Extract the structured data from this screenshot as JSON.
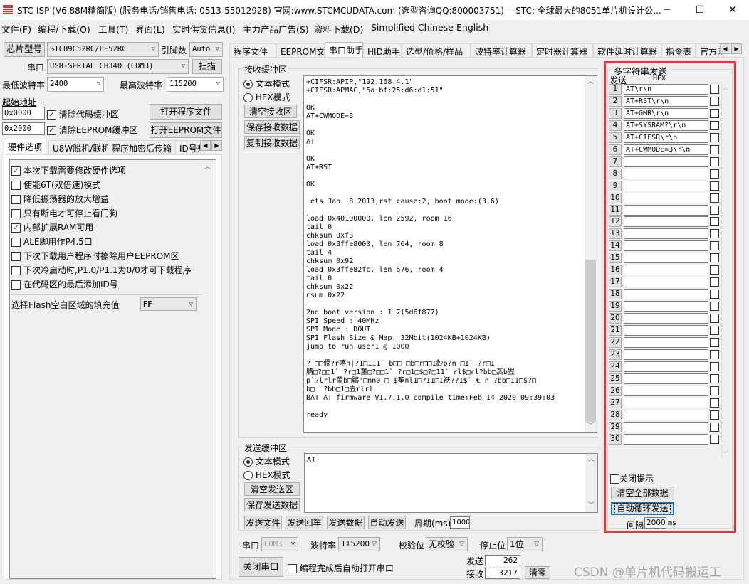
{
  "window": {
    "title": "STC-ISP (V6.88M精简版) (服务电话/销售电话: 0513-55012928) 官网:www.STCMCUDATA.com  (选型咨询QQ:800003751) -- STC: 全球最大的8051单片机设计公...",
    "minimize": "─",
    "maximize": "☐",
    "close": "✕"
  },
  "menu": [
    "文件(F)",
    "编程/下载(O)",
    "工具(T)",
    "界面(L)",
    "实时供货信息(I)",
    "主力产品广告(S)",
    "资料下载(D)",
    "Simplified Chinese",
    "English"
  ],
  "left": {
    "chip_button": "芯片型号",
    "chip_value": "STC89C52RC/LE52RC",
    "pins_label": "引脚数",
    "pins_value": "Auto",
    "port_label": "串口",
    "port_value": "USB-SERIAL CH340 (COM3)",
    "scan_button": "扫描",
    "min_baud_label": "最低波特率",
    "min_baud_value": "2400",
    "max_baud_label": "最高波特率",
    "max_baud_value": "115200",
    "start_addr_label": "起始地址",
    "addr1": "0x0000",
    "clear_code": "清除代码缓冲区",
    "open_prog": "打开程序文件",
    "addr2": "0x2000",
    "clear_eeprom": "清除EEPROM缓冲区",
    "open_eeprom": "打开EEPROM文件",
    "tabs": [
      "硬件选项",
      "U8W脱机/联机",
      "程序加密后传输",
      "ID号升"
    ],
    "options": [
      {
        "label": "本次下载需要修改硬件选项",
        "checked": true
      },
      {
        "label": "使能6T(双倍速)模式",
        "checked": false
      },
      {
        "label": "降低振荡器的放大增益",
        "checked": false
      },
      {
        "label": "只有断电才可停止看门狗",
        "checked": false
      },
      {
        "label": "内部扩展RAM可用",
        "checked": true
      },
      {
        "label": "ALE脚用作P4.5口",
        "checked": false
      },
      {
        "label": "下次下载用户程序时擦除用户EEPROM区",
        "checked": false
      },
      {
        "label": "下次冷启动时,P1.0/P1.1为0/0才可下载程序",
        "checked": false
      },
      {
        "label": "在代码区的最后添加ID号",
        "checked": false
      }
    ],
    "fill_label": "选择Flash空白区域的填充值",
    "fill_value": "FF"
  },
  "tabs": [
    "程序文件",
    "EEPROM文件",
    "串口助手",
    "HID助手",
    "选型/价格/样品",
    "波特率计算器",
    "定时器计算器",
    "软件延时计算器",
    "指令表",
    "官方网"
  ],
  "active_tab": 2,
  "receive": {
    "title": "接收缓冲区",
    "text_mode": "文本模式",
    "hex_mode": "HEX模式",
    "clear": "清空接收区",
    "save": "保存接收数据",
    "copy": "复制接收数据",
    "lines": [
      "+CIFSR:APIP,\"192.168.4.1\"",
      "+CIFSR:APMAC,\"5a:bf:25:d6:d1:51\"",
      "",
      "OK",
      "AT+CWMODE=3",
      "",
      "OK",
      "AT",
      "",
      "OK",
      "AT+RST",
      "",
      "OK",
      "",
      " ets Jan  8 2013,rst cause:2, boot mode:(3,6)",
      "",
      "load 0x40100000, len 2592, room 16",
      "tail 0",
      "chksum 0xf3",
      "load 0x3ffe8000, len 764, room 8",
      "tail 4",
      "chksum 0x92",
      "load 0x3ffe82fc, len 676, room 4",
      "tail 0",
      "chksum 0x22",
      "csum 0x22",
      "",
      "2nd boot version : 1.7(5d6f877)",
      "SPI Speed : 40MHz",
      "SPI Mode : DOUT",
      "SPI Flash Size & Map: 32Mbit(1024KB+1024KB)",
      "jump to run user1 @ 1000",
      "",
      "? □□僴?r喀n|?1□111` b□□ □b□r□□1鈔b?n □1` ?r□1",
      "腈□?□□1` ?r□1菫□?□□1` ?r□1□$□?□11` rl$□rl?bb□蒸b岦",
      "p`?lrlr菫b□鶤'□nn0 □ $筝nl1□?11□1袄??1$` € n ?bb□11□$?□",
      "b□  ?bb□1□岦rlrl",
      "BAT AT firmware V1.7.1.0 compile time:Feb 14 2020 09:39:03",
      "",
      "ready"
    ]
  },
  "send": {
    "title": "发送缓冲区",
    "text_mode": "文本模式",
    "hex_mode": "HEX模式",
    "clear": "清空发送区",
    "save": "保存发送数据",
    "content": "AT",
    "send_file": "发送文件",
    "send_enter": "发送回车",
    "send_data": "发送数据",
    "auto_send": "自动发送",
    "period_label": "周期(ms)",
    "period_value": "1000"
  },
  "serial": {
    "port_label": "串口",
    "port_value": "COM3",
    "baud_label": "波特率",
    "baud_value": "115200",
    "parity_label": "校验位",
    "parity_value": "无校验",
    "stop_label": "停止位",
    "stop_value": "1位",
    "close_port": "关闭串口",
    "auto_open": "编程完成后自动打开串口",
    "sent_label": "发送",
    "sent_value": "262",
    "recv_label": "接收",
    "recv_value": "3217",
    "reset": "清零"
  },
  "multi": {
    "title": "多字符串发送",
    "send_col": "发送",
    "hex_col": "HEX",
    "rows": [
      "AT\\r\\n",
      "AT+RST\\r\\n",
      "AT+GMR\\r\\n",
      "AT+SYSRAM?\\r\\n",
      "AT+CIFSR\\r\\n",
      "AT+CWMODE=3\\r\\n",
      "",
      "",
      "",
      "",
      "",
      "",
      "",
      "",
      "",
      "",
      "",
      "",
      "",
      "",
      "",
      "",
      "",
      "",
      "",
      "",
      "",
      "",
      "",
      ""
    ],
    "close_hint": "关闭提示",
    "clear_all": "清空全部数据",
    "auto_loop": "自动循环发送",
    "interval_label": "间隔",
    "interval_value": "2000",
    "interval_unit": "ms",
    "highlight_color": "#f03030"
  },
  "watermark": "CSDN @单片机代码搬运工"
}
